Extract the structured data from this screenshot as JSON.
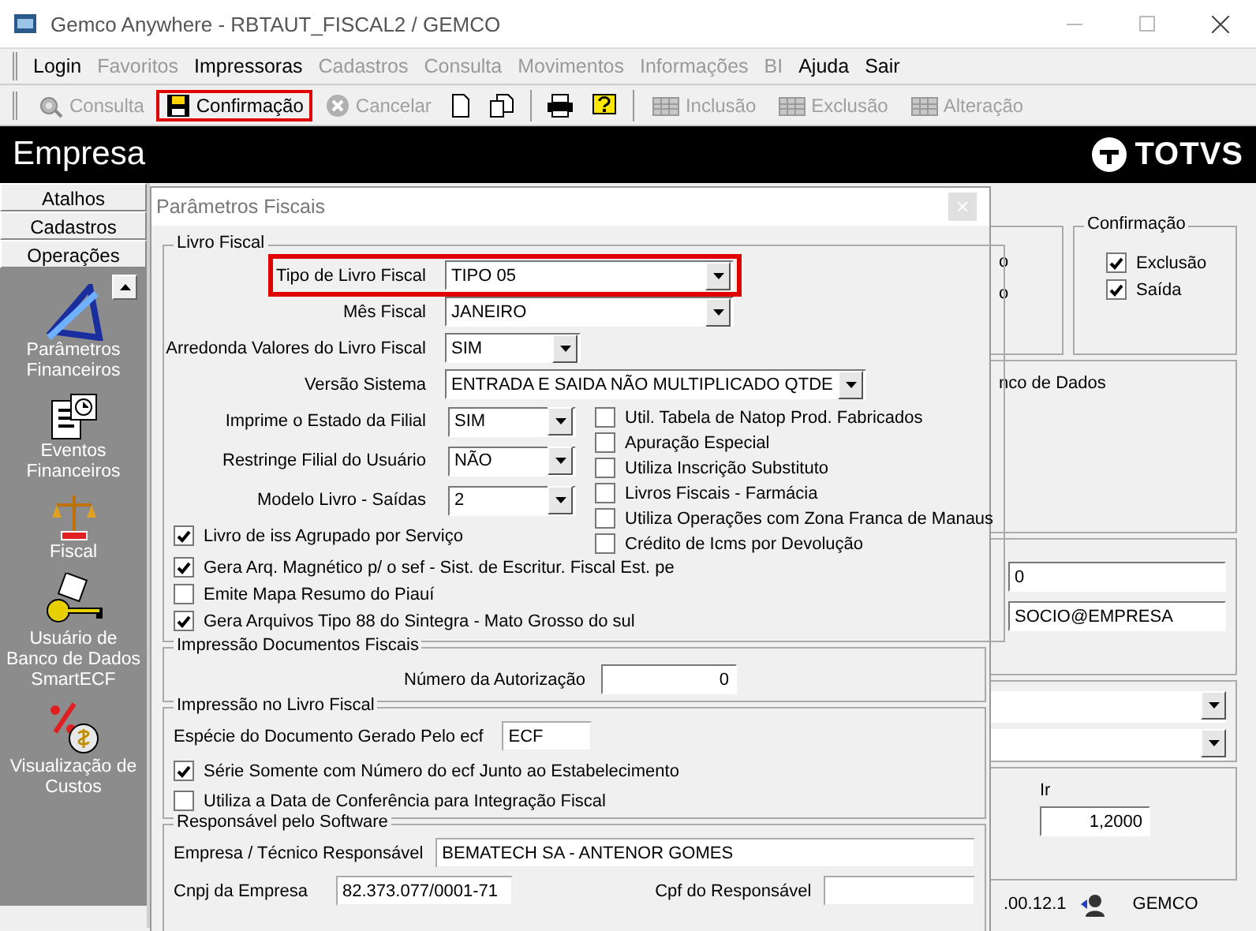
{
  "window": {
    "title": "Gemco Anywhere - RBTAUT_FISCAL2 / GEMCO"
  },
  "menu": [
    {
      "label": "Login",
      "disabled": false
    },
    {
      "label": "Favoritos",
      "disabled": true
    },
    {
      "label": "Impressoras",
      "disabled": false
    },
    {
      "label": "Cadastros",
      "disabled": true
    },
    {
      "label": "Consulta",
      "disabled": true
    },
    {
      "label": "Movimentos",
      "disabled": true
    },
    {
      "label": "Informações",
      "disabled": true
    },
    {
      "label": "BI",
      "disabled": true
    },
    {
      "label": "Ajuda",
      "disabled": false
    },
    {
      "label": "Sair",
      "disabled": false
    }
  ],
  "toolbar": [
    {
      "kind": "button",
      "label": "Consulta",
      "disabled": true,
      "highlighted": false
    },
    {
      "kind": "button",
      "label": "Confirmação",
      "disabled": false,
      "highlighted": true
    },
    {
      "kind": "button",
      "label": "Cancelar",
      "disabled": true,
      "highlighted": false
    },
    {
      "kind": "new-document"
    },
    {
      "kind": "copy-document"
    },
    {
      "kind": "separator"
    },
    {
      "kind": "printer"
    },
    {
      "kind": "help"
    },
    {
      "kind": "separator"
    },
    {
      "kind": "button",
      "label": "Inclusão",
      "disabled": true,
      "highlighted": false
    },
    {
      "kind": "button",
      "label": "Exclusão",
      "disabled": true,
      "highlighted": false
    },
    {
      "kind": "button",
      "label": "Alteração",
      "disabled": true,
      "highlighted": false
    }
  ],
  "header": {
    "title": "Empresa",
    "logo": "TOTVS"
  },
  "sidebar": {
    "tabs": [
      "Atalhos",
      "Cadastros",
      "Operações"
    ],
    "items": [
      {
        "label": "Parâmetros Financeiros"
      },
      {
        "label": "Eventos Financeiros"
      },
      {
        "label": "Fiscal"
      },
      {
        "label": "Usuário de Banco de Dados SmartECF"
      },
      {
        "label": "Visualização de Custos"
      }
    ]
  },
  "background": {
    "group_labels": [
      "o",
      "o"
    ],
    "confirmacao": {
      "title": "Confirmação",
      "checkboxes": [
        {
          "label": "Exclusão",
          "checked": true
        },
        {
          "label": "Saída",
          "checked": true
        }
      ]
    },
    "database_label": "nco de Dados",
    "fields": [
      "0",
      "SOCIO@EMPRESA"
    ],
    "ir": {
      "label": "Ir",
      "value": "1,2000"
    },
    "status_bar": {
      "version": ".00.12.1",
      "user": "GEMCO"
    }
  },
  "dialog": {
    "title": "Parâmetros Fiscais",
    "livro_fiscal": {
      "title": "Livro Fiscal",
      "fields": [
        {
          "label": "Tipo de Livro Fiscal",
          "value": "TIPO 05",
          "kind": "combo",
          "highlighted": true
        },
        {
          "label": "Mês Fiscal",
          "value": "JANEIRO",
          "kind": "combo",
          "highlighted": false
        },
        {
          "label": "Arredonda Valores do Livro Fiscal",
          "value": "SIM",
          "kind": "combo",
          "highlighted": false
        },
        {
          "label": "Versão Sistema",
          "value": "ENTRADA E SAIDA NÃO MULTIPLICADO QTDE",
          "kind": "combo",
          "highlighted": false
        }
      ],
      "side_fields": [
        {
          "label": "Imprime o Estado da Filial",
          "value": "SIM",
          "kind": "combo"
        },
        {
          "label": "Restringe Filial do Usuário",
          "value": "NÃO",
          "kind": "combo"
        },
        {
          "label": "Modelo Livro - Saídas",
          "value": "2",
          "kind": "combo"
        }
      ],
      "side_checkboxes": [
        {
          "label": "Util. Tabela de Natop Prod. Fabricados",
          "checked": false
        },
        {
          "label": "Apuração Especial",
          "checked": false
        },
        {
          "label": "Utiliza Inscrição Substituto",
          "checked": false
        },
        {
          "label": "Livros Fiscais - Farmácia",
          "checked": false
        },
        {
          "label": "Utiliza Operações com Zona Franca de Manaus",
          "checked": false
        },
        {
          "label": "Crédito de Icms por Devolução",
          "checked": false
        }
      ],
      "checkboxes": [
        {
          "label": "Livro de iss Agrupado por Serviço",
          "checked": true
        },
        {
          "label": "Gera Arq. Magnético p/ o sef - Sist. de Escritur. Fiscal Est. pe",
          "checked": true
        },
        {
          "label": "Emite Mapa Resumo do Piauí",
          "checked": false
        },
        {
          "label": "Gera Arquivos Tipo 88 do Sintegra - Mato Grosso do sul",
          "checked": true
        }
      ]
    },
    "impressao_documentos": {
      "title": "Impressão Documentos Fiscais",
      "field": {
        "label": "Número da Autorização",
        "value": "0",
        "kind": "number"
      }
    },
    "impressao_livro": {
      "title": "Impressão no Livro Fiscal",
      "field": {
        "label": "Espécie do Documento Gerado Pelo ecf",
        "value": "ECF"
      },
      "checkboxes": [
        {
          "label": "Série Somente com Número do ecf Junto ao Estabelecimento",
          "checked": true
        },
        {
          "label": "Utiliza a Data de Conferência para Integração Fiscal",
          "checked": false
        }
      ]
    },
    "responsavel": {
      "title": "Responsável pelo Software",
      "empresa": {
        "label": "Empresa / Técnico Responsável",
        "value": "BEMATECH SA - ANTENOR GOMES"
      },
      "cnpj": {
        "label": "Cnpj da Empresa",
        "value": "82.373.077/0001-71"
      },
      "cpf": {
        "label": "Cpf do Responsável"
      }
    }
  }
}
